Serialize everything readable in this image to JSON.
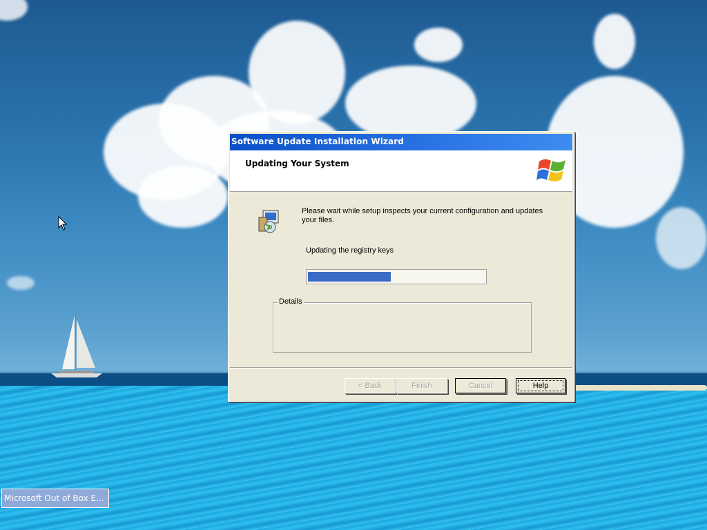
{
  "window": {
    "title": "Software Update Installation Wizard",
    "header_title": "Updating Your System",
    "message": "Please wait while setup inspects your current configuration and updates your files.",
    "status": "Updating the registry keys",
    "progress_fraction": 0.47,
    "details_label": "Details",
    "icons": {
      "logo": "windows-logo-icon",
      "setup": "setup-computer-cd-icon"
    }
  },
  "buttons": {
    "back": "< Back",
    "finish": "Finish",
    "cancel": "Cancel",
    "help": "Help"
  },
  "taskbar": {
    "task_label": "Microsoft Out of Box E..."
  },
  "colors": {
    "titlebar": "#0a50c8",
    "progress_fill": "#3a6cc6",
    "dialog_bg": "#ece9d8"
  }
}
